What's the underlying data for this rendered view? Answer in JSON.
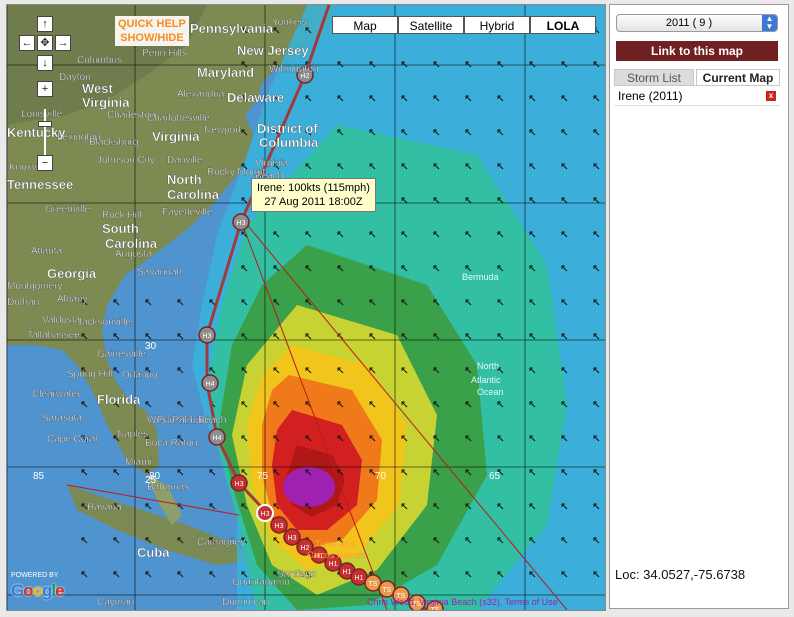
{
  "map": {
    "types": [
      {
        "label": "Map",
        "active": false
      },
      {
        "label": "Satellite",
        "active": false
      },
      {
        "label": "Hybrid",
        "active": false
      },
      {
        "label": "LOLA",
        "active": true
      }
    ],
    "quick_help": {
      "line1": "QUICK HELP",
      "line2": "SHOW/HIDE"
    },
    "tooltip": {
      "line1": "Irene: 100kts (115mph)",
      "line2": "27 Aug 2011 18:00Z"
    },
    "powered_by": "POWERED BY",
    "google_logo": "Google",
    "attribution": "Chris Wood, Virginia Beach (s32), Terms of Use",
    "nav_icons": [
      "arrow-up-icon",
      "arrow-left-icon",
      "arrow-right-icon",
      "arrow-down-icon",
      "center-icon",
      "plus-icon",
      "minus-icon"
    ],
    "grid_labels": {
      "lat": [
        "30",
        "25"
      ],
      "lon": [
        "85",
        "80",
        "75",
        "70",
        "65"
      ]
    },
    "place_labels": [
      {
        "name": "Pennsylvania",
        "kind": "state"
      },
      {
        "name": "Yonkers",
        "kind": "city"
      },
      {
        "name": "New Jersey",
        "kind": "state"
      },
      {
        "name": "Columbus",
        "kind": "city"
      },
      {
        "name": "Penn Hills",
        "kind": "city"
      },
      {
        "name": "Dayton",
        "kind": "city"
      },
      {
        "name": "Maryland",
        "kind": "state"
      },
      {
        "name": "Wilmington",
        "kind": "city"
      },
      {
        "name": "West",
        "kind": "state"
      },
      {
        "name": "Virginia",
        "kind": "state"
      },
      {
        "name": "Alexandria",
        "kind": "city"
      },
      {
        "name": "Delaware",
        "kind": "state"
      },
      {
        "name": "Louisville",
        "kind": "city"
      },
      {
        "name": "Charleston",
        "kind": "city"
      },
      {
        "name": "Charlottesville",
        "kind": "city"
      },
      {
        "name": "Kentucky",
        "kind": "state"
      },
      {
        "name": "Lexington",
        "kind": "city"
      },
      {
        "name": "Blacksburg",
        "kind": "city"
      },
      {
        "name": "Virginia",
        "kind": "state"
      },
      {
        "name": "Newport",
        "kind": "city"
      },
      {
        "name": "District of",
        "kind": "state"
      },
      {
        "name": "Columbia",
        "kind": "state"
      },
      {
        "name": "Knoxville",
        "kind": "city"
      },
      {
        "name": "Johnson City",
        "kind": "city"
      },
      {
        "name": "Danville",
        "kind": "city"
      },
      {
        "name": "Virginia",
        "kind": "city"
      },
      {
        "name": "Beach",
        "kind": "city"
      },
      {
        "name": "Tennessee",
        "kind": "state"
      },
      {
        "name": "North",
        "kind": "state"
      },
      {
        "name": "Carolina",
        "kind": "state"
      },
      {
        "name": "Rocky Mount",
        "kind": "city"
      },
      {
        "name": "Greenville",
        "kind": "city"
      },
      {
        "name": "Rock Hill",
        "kind": "city"
      },
      {
        "name": "Fayetteville",
        "kind": "city"
      },
      {
        "name": "South",
        "kind": "state"
      },
      {
        "name": "Carolina",
        "kind": "state"
      },
      {
        "name": "Atlanta",
        "kind": "city"
      },
      {
        "name": "Augusta",
        "kind": "city"
      },
      {
        "name": "Georgia",
        "kind": "state"
      },
      {
        "name": "Montgomery",
        "kind": "city"
      },
      {
        "name": "Dothan",
        "kind": "city"
      },
      {
        "name": "Albany",
        "kind": "city"
      },
      {
        "name": "Savannah",
        "kind": "city"
      },
      {
        "name": "Bermuda",
        "kind": "ocean"
      },
      {
        "name": "Tallahassee",
        "kind": "city"
      },
      {
        "name": "Jacksonville",
        "kind": "city"
      },
      {
        "name": "Valdosta",
        "kind": "city"
      },
      {
        "name": "Gainesville",
        "kind": "city"
      },
      {
        "name": "North",
        "kind": "ocean"
      },
      {
        "name": "Atlantic",
        "kind": "ocean"
      },
      {
        "name": "Ocean",
        "kind": "ocean"
      },
      {
        "name": "Spring Hill",
        "kind": "city"
      },
      {
        "name": "Orlando",
        "kind": "city"
      },
      {
        "name": "Clearwater",
        "kind": "city"
      },
      {
        "name": "Florida",
        "kind": "state"
      },
      {
        "name": "Sarasota",
        "kind": "city"
      },
      {
        "name": "Port St Lucie",
        "kind": "city"
      },
      {
        "name": "Cape Coral",
        "kind": "city"
      },
      {
        "name": "Naples",
        "kind": "city"
      },
      {
        "name": "West Palm Beach",
        "kind": "city"
      },
      {
        "name": "Boca Raton",
        "kind": "city"
      },
      {
        "name": "Miami",
        "kind": "city"
      },
      {
        "name": "Bahamas",
        "kind": "city"
      },
      {
        "name": "Havana",
        "kind": "city"
      },
      {
        "name": "Cuba",
        "kind": "state"
      },
      {
        "name": "Camagüey",
        "kind": "city"
      },
      {
        "name": "Turks and",
        "kind": "island"
      },
      {
        "name": "Caicos Islands",
        "kind": "island"
      },
      {
        "name": "Guantanamo",
        "kind": "city"
      },
      {
        "name": "Santiago",
        "kind": "city"
      },
      {
        "name": "Cayman",
        "kind": "city"
      },
      {
        "name": "Dominican",
        "kind": "city"
      }
    ],
    "track_points": [
      {
        "label": "H2"
      },
      {
        "label": "H3"
      },
      {
        "label": "H3"
      },
      {
        "label": "H4"
      },
      {
        "label": "H4"
      },
      {
        "label": "H3"
      },
      {
        "label": "H3"
      },
      {
        "label": "H3"
      },
      {
        "label": "H3"
      },
      {
        "label": "H2"
      },
      {
        "label": "H1"
      },
      {
        "label": "H1"
      },
      {
        "label": "H1"
      },
      {
        "label": "H1"
      },
      {
        "label": "TS"
      },
      {
        "label": "TS"
      },
      {
        "label": "TS"
      },
      {
        "label": "TS"
      },
      {
        "label": "TS"
      }
    ],
    "colors": {
      "track": "#a33a3a",
      "track_marker": "#8e8e8e",
      "wind_purple": "#a020b0",
      "wind_red": "#d21f1f",
      "wind_orange": "#f07a1a",
      "wind_yellow": "#f2c51c",
      "wind_green": "#3aa04a",
      "wind_teal": "#32bfa3",
      "wind_cyan": "#3fcfe0",
      "ocean_blue": "#4f93cf"
    }
  },
  "sidebar": {
    "year_select": "2011 ( 9 )",
    "link_button": "Link to this map",
    "tabs": [
      {
        "label": "Storm List",
        "active": false
      },
      {
        "label": "Current Map",
        "active": true
      }
    ],
    "storms": [
      {
        "name": "Irene (2011)"
      }
    ],
    "remove_icon": "close-icon",
    "location": "Loc: 34.0527,-75.6738"
  }
}
